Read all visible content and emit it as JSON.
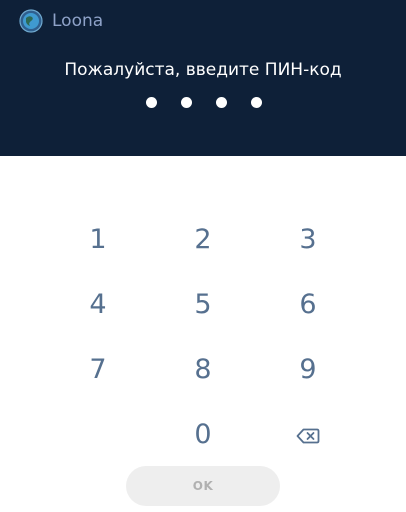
{
  "app": {
    "name": "Loona",
    "logo_icon": "loona-globe-icon"
  },
  "prompt": "Пожалуйста, введите ПИН-код",
  "pin": {
    "length": 4,
    "entered": 4
  },
  "keypad": {
    "keys": [
      "1",
      "2",
      "3",
      "4",
      "5",
      "6",
      "7",
      "8",
      "9",
      "0"
    ],
    "backspace_icon": "backspace-icon"
  },
  "ok_button": {
    "label": "OK",
    "enabled": false
  },
  "colors": {
    "header_background": "#0e2038",
    "key_text": "#56708f",
    "ok_background": "#eeeeee",
    "ok_text": "#b1b1b1"
  }
}
